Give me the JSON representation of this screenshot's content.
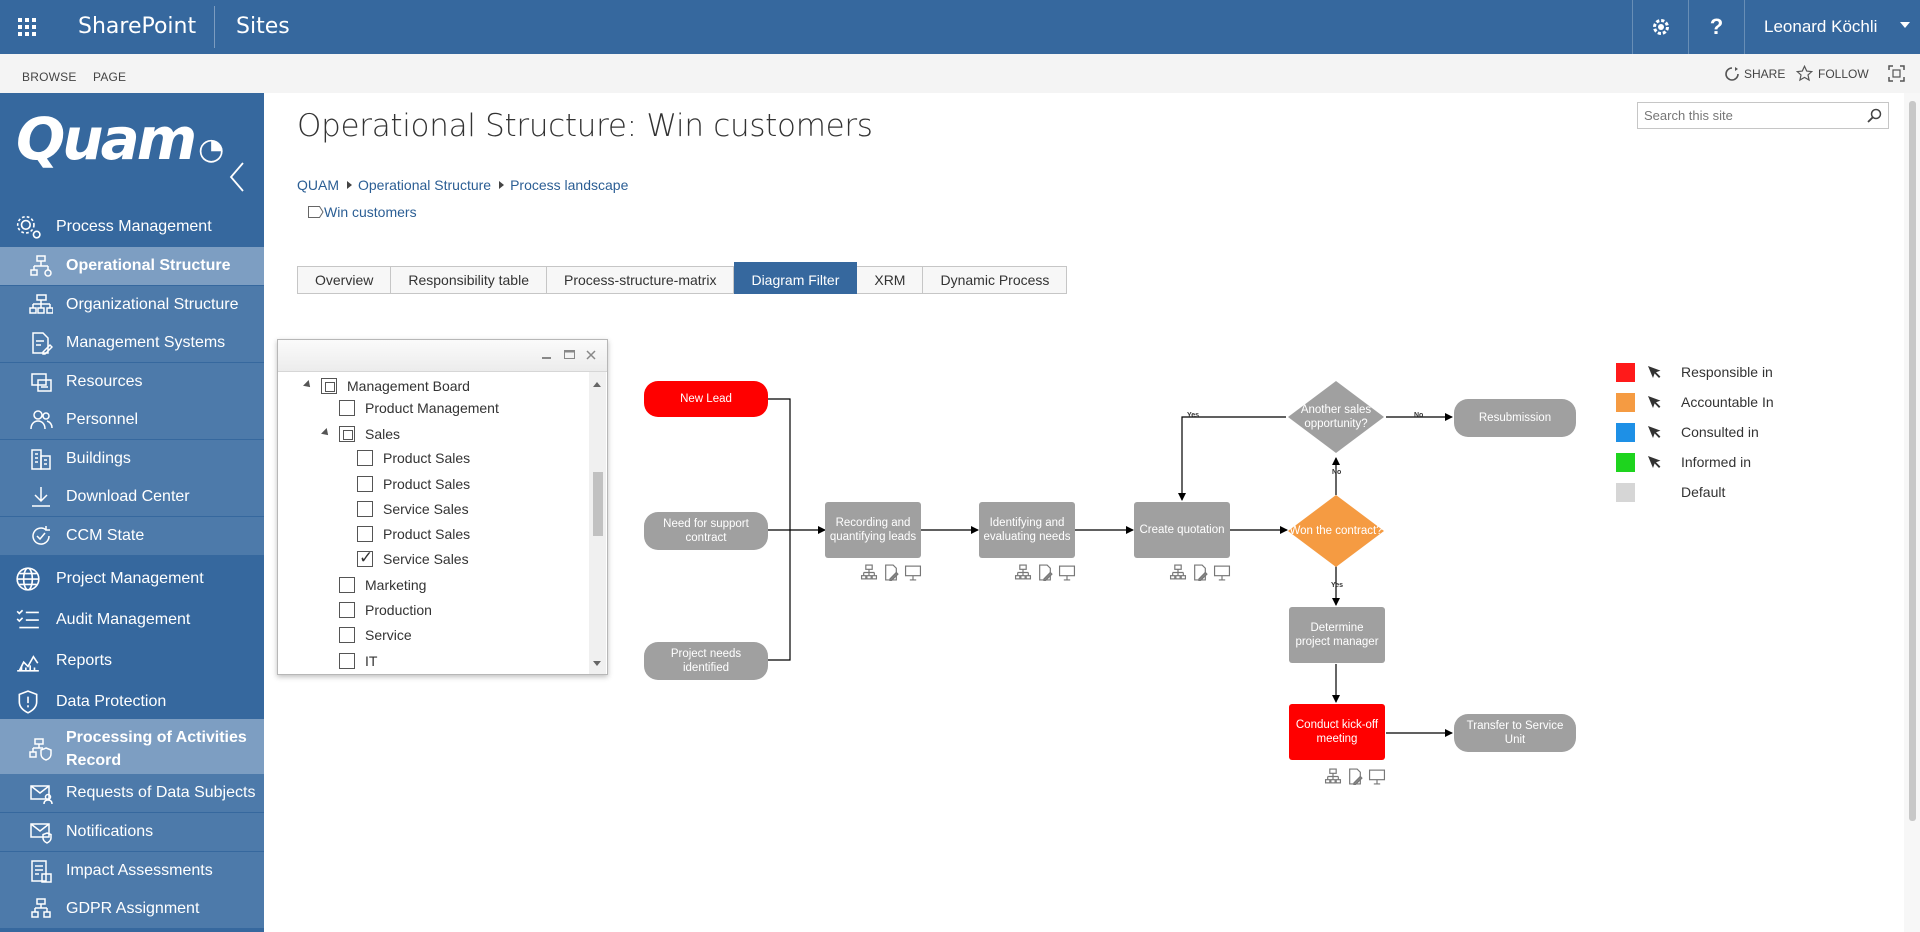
{
  "suitebar": {
    "brand": "SharePoint",
    "sites": "Sites",
    "user": "Leonard Köchli",
    "help": "?"
  },
  "ribbon": {
    "browse": "BROWSE",
    "page": "PAGE",
    "share": "SHARE",
    "follow": "FOLLOW"
  },
  "logo": "Quam",
  "nav": [
    {
      "label": "Process Management",
      "level": 1,
      "icon": "gears-icon"
    },
    {
      "label": "Operational Structure",
      "level": 2,
      "icon": "process-flow-icon",
      "selected": true
    },
    {
      "label": "Organizational Structure",
      "level": 2,
      "icon": "org-chart-icon"
    },
    {
      "label": "Management Systems",
      "level": 2,
      "icon": "document-edit-icon"
    },
    {
      "label": "Resources",
      "level": 2,
      "icon": "resources-icon"
    },
    {
      "label": "Personnel",
      "level": 2,
      "icon": "people-icon"
    },
    {
      "label": "Buildings",
      "level": 2,
      "icon": "building-icon"
    },
    {
      "label": "Download Center",
      "level": 2,
      "icon": "download-icon"
    },
    {
      "label": "CCM State",
      "level": 2,
      "icon": "cycle-icon"
    },
    {
      "label": "Project Management",
      "level": 1,
      "icon": "globe-icon"
    },
    {
      "label": "Audit Management",
      "level": 1,
      "icon": "audit-list-icon"
    },
    {
      "label": "Reports",
      "level": 1,
      "icon": "reports-chart-icon"
    },
    {
      "label": "Data Protection",
      "level": 1,
      "icon": "shield-icon"
    },
    {
      "label": "Processing of Activities Record",
      "level": 2,
      "icon": "process-shield-icon",
      "selected": true
    },
    {
      "label": "Requests of Data Subjects",
      "level": 2,
      "icon": "mail-person-icon"
    },
    {
      "label": "Notifications",
      "level": 2,
      "icon": "mail-shield-icon"
    },
    {
      "label": "Impact Assessments",
      "level": 2,
      "icon": "assessment-icon"
    },
    {
      "label": "GDPR Assignment",
      "level": 2,
      "icon": "gdpr-icon"
    }
  ],
  "page": {
    "title": "Operational Structure: Win customers",
    "search_placeholder": "Search this site",
    "breadcrumb": [
      "QUAM",
      "Operational Structure",
      "Process landscape"
    ],
    "current": "Win customers"
  },
  "tabs": [
    "Overview",
    "Responsibility table",
    "Process-structure-matrix",
    "Diagram Filter",
    "XRM",
    "Dynamic Process"
  ],
  "active_tab": "Diagram Filter",
  "filter_tree": [
    {
      "label": "Management Board",
      "indent": 0,
      "state": "partial",
      "expanded": true
    },
    {
      "label": "Product Management",
      "indent": 1,
      "state": "unchecked"
    },
    {
      "label": "Sales",
      "indent": 1,
      "state": "partial",
      "expanded": true
    },
    {
      "label": "Product Sales",
      "indent": 2,
      "state": "unchecked"
    },
    {
      "label": "Product Sales",
      "indent": 2,
      "state": "unchecked"
    },
    {
      "label": "Service Sales",
      "indent": 2,
      "state": "unchecked"
    },
    {
      "label": "Product Sales",
      "indent": 2,
      "state": "unchecked"
    },
    {
      "label": "Service Sales",
      "indent": 2,
      "state": "checked"
    },
    {
      "label": "Marketing",
      "indent": 1,
      "state": "unchecked"
    },
    {
      "label": "Production",
      "indent": 1,
      "state": "unchecked"
    },
    {
      "label": "Service",
      "indent": 1,
      "state": "unchecked"
    },
    {
      "label": "IT",
      "indent": 1,
      "state": "unchecked"
    }
  ],
  "diagram": {
    "new_lead": "New Lead",
    "need_support": "Need for support contract",
    "project_needs": "Project needs identified",
    "recording": "Recording and quantifying leads",
    "identifying": "Identifying and evaluating needs",
    "quotation": "Create quotation",
    "won": "Won the contract?",
    "another": "Another sales opportunity?",
    "resubmission": "Resubmission",
    "determine": "Determine project manager",
    "kickoff": "Conduct kick-off meeting",
    "transfer": "Transfer to Service Unit",
    "yes1": "Yes",
    "no1": "No",
    "no2": "No",
    "yes2": "Yes"
  },
  "legend": [
    {
      "label": "Responsible in",
      "color": "#ff1a1a"
    },
    {
      "label": "Accountable In",
      "color": "#f59b42"
    },
    {
      "label": "Consulted in",
      "color": "#1e90e6"
    },
    {
      "label": "Informed in",
      "color": "#1ed41e"
    },
    {
      "label": "Default",
      "color": "#d6d6d6"
    }
  ],
  "colors": {
    "suitebar": "#36689e",
    "nav_selected": "#7d9ec2",
    "node_grey": "#a0a0a0",
    "node_red": "#ff0000",
    "decision_orange": "#f59b42"
  }
}
